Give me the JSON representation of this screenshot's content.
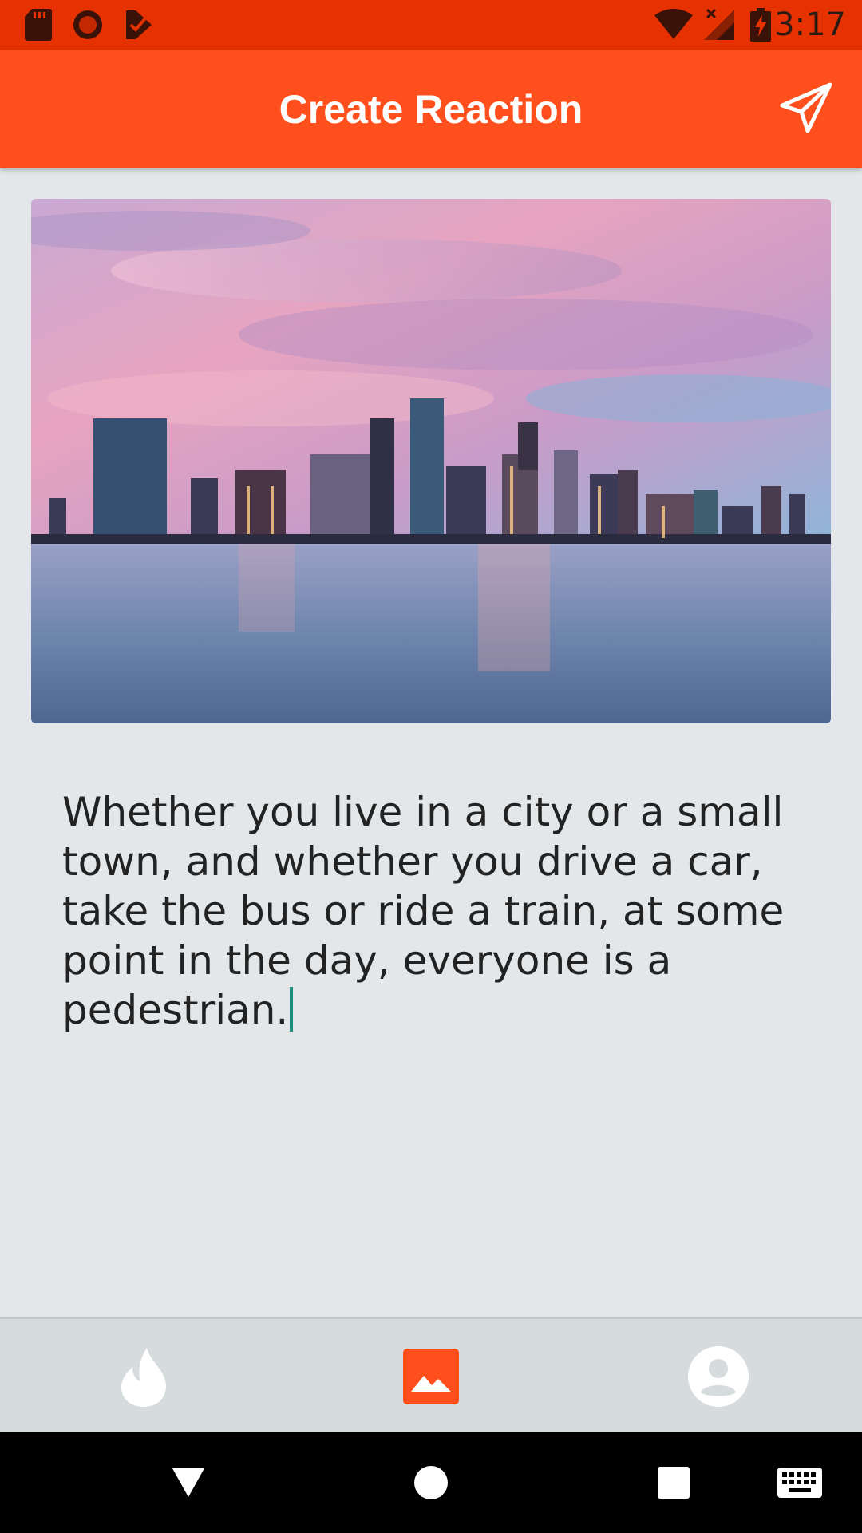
{
  "status_bar": {
    "time": "3:17",
    "left_icons": [
      "sd-card-icon",
      "record-icon",
      "checklist-icon"
    ],
    "right_icons": [
      "wifi-icon",
      "signal-icon",
      "battery-charging-icon"
    ]
  },
  "app_bar": {
    "title": "Create Reaction",
    "send_icon": "send-icon"
  },
  "content": {
    "image_icon": "city-skyline-photo",
    "reaction_text": "Whether you live in a city or a small town, and whether you drive a car, take the bus or ride a train, at some point in the day, everyone is a pedestrian."
  },
  "bottom_nav": {
    "items": [
      {
        "icon": "flame-icon",
        "active": false
      },
      {
        "icon": "image-icon",
        "active": true
      },
      {
        "icon": "profile-icon",
        "active": false
      }
    ]
  },
  "system_nav": {
    "buttons": [
      "back-icon",
      "home-icon",
      "recents-icon",
      "keyboard-icon"
    ]
  },
  "colors": {
    "status_bar": "#e63200",
    "app_bar": "#ff4f1c",
    "background": "#e3e7ea",
    "accent": "#ff4f1c",
    "caret": "#1a8c7c"
  }
}
